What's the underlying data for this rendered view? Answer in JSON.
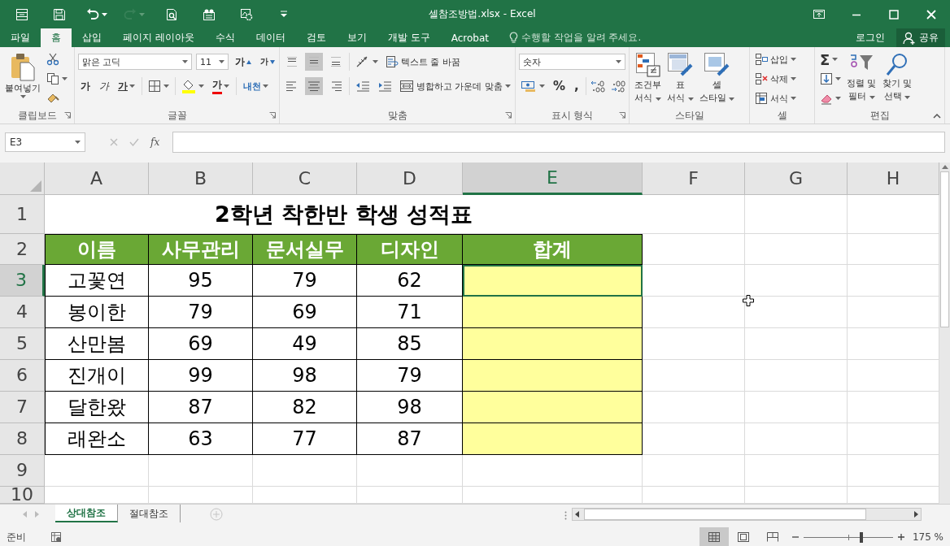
{
  "title_bar": {
    "title": "셀참조방법.xlsx - Excel",
    "quick_access": [
      {
        "kind": "form",
        "disabled": false
      },
      {
        "kind": "save",
        "disabled": false
      },
      {
        "kind": "undo",
        "disabled": false
      },
      {
        "kind": "redo",
        "disabled": true
      },
      {
        "kind": "preview",
        "disabled": false
      },
      {
        "kind": "camera",
        "disabled": false
      },
      {
        "kind": "gear",
        "disabled": false
      },
      {
        "kind": "customize",
        "disabled": false
      }
    ]
  },
  "tabs": [
    {
      "label": "파일",
      "selected": false
    },
    {
      "label": "홈",
      "selected": true
    },
    {
      "label": "삽입",
      "selected": false
    },
    {
      "label": "페이지 레이아웃",
      "selected": false
    },
    {
      "label": "수식",
      "selected": false
    },
    {
      "label": "데이터",
      "selected": false
    },
    {
      "label": "검토",
      "selected": false
    },
    {
      "label": "보기",
      "selected": false
    },
    {
      "label": "개발 도구",
      "selected": false
    },
    {
      "label": "Acrobat",
      "selected": false
    }
  ],
  "tell_me": "수행할 작업을 알려 주세요.",
  "account": {
    "login": "로그인",
    "share": "공유"
  },
  "ribbon": {
    "groups": [
      {
        "kind": "clipboard",
        "label": "클립보드",
        "paste": "붙여넣기"
      },
      {
        "kind": "font",
        "label": "글꼴",
        "font_name": "맑은 고딕",
        "font_size": "11",
        "grow": "가",
        "shrink": "가",
        "bold": "가",
        "italic": "가",
        "underline": "가",
        "font_color": "가",
        "phonetic": "내천"
      },
      {
        "kind": "alignment",
        "label": "맞춤",
        "wrap": "텍스트 줄 바꿈",
        "merge": "병합하고 가운데 맞춤",
        "vertical_align": [
          {
            "selected": false
          },
          {
            "selected": true
          },
          {
            "selected": false
          }
        ],
        "horizontal_align": [
          {
            "selected": false
          },
          {
            "selected": true
          },
          {
            "selected": false
          }
        ]
      },
      {
        "kind": "number",
        "label": "표시 형식",
        "format": "숫자",
        "percent": "%",
        "comma": ","
      },
      {
        "kind": "styles",
        "label": "스타일",
        "buttons": [
          [
            "조건부",
            "서식"
          ],
          [
            "표",
            "서식"
          ],
          [
            "셀",
            "스타일"
          ]
        ]
      },
      {
        "kind": "cells",
        "label": "셀",
        "buttons": [
          "삽입",
          "삭제",
          "서식"
        ]
      },
      {
        "kind": "editing",
        "label": "편집",
        "sum": "Σ",
        "buttons": [
          [
            "정렬 및",
            "필터"
          ],
          [
            "찾기 및",
            "선택"
          ]
        ]
      }
    ]
  },
  "formula_bar": {
    "name_box": "E3",
    "fx": "fx"
  },
  "sheet": {
    "columns": [
      {
        "label": "A",
        "selected": false
      },
      {
        "label": "B",
        "selected": false
      },
      {
        "label": "C",
        "selected": false
      },
      {
        "label": "D",
        "selected": false
      },
      {
        "label": "E",
        "selected": true
      },
      {
        "label": "F",
        "selected": false
      },
      {
        "label": "G",
        "selected": false
      },
      {
        "label": "H",
        "selected": false
      }
    ],
    "rows": [
      {
        "label": "1",
        "selected": false,
        "kind": "title",
        "text": "2학년 착한반 학생 성적표"
      },
      {
        "label": "2",
        "selected": false,
        "kind": "header",
        "cells": [
          "이름",
          "사무관리",
          "문서실무",
          "디자인",
          "합계"
        ]
      },
      {
        "label": "3",
        "selected": true,
        "kind": "data",
        "cells": [
          "고꽃연",
          "95",
          "79",
          "62"
        ]
      },
      {
        "label": "4",
        "selected": false,
        "kind": "data",
        "cells": [
          "봉이한",
          "79",
          "69",
          "71"
        ]
      },
      {
        "label": "5",
        "selected": false,
        "kind": "data",
        "cells": [
          "산만봄",
          "69",
          "49",
          "85"
        ]
      },
      {
        "label": "6",
        "selected": false,
        "kind": "data",
        "cells": [
          "진개이",
          "99",
          "98",
          "79"
        ]
      },
      {
        "label": "7",
        "selected": false,
        "kind": "data",
        "cells": [
          "달한왔",
          "87",
          "82",
          "98"
        ]
      },
      {
        "label": "8",
        "selected": false,
        "kind": "data",
        "cells": [
          "래완소",
          "63",
          "77",
          "87"
        ]
      },
      {
        "label": "9",
        "selected": false,
        "kind": "empty"
      },
      {
        "label": "10",
        "selected": false,
        "kind": "empty"
      }
    ]
  },
  "sheet_tabs": [
    {
      "label": "상대참조",
      "selected": true
    },
    {
      "label": "절대참조",
      "selected": false
    }
  ],
  "status_bar": {
    "status": "준비",
    "views": [
      {
        "kind": "normal",
        "selected": true
      },
      {
        "kind": "page_layout",
        "selected": false
      },
      {
        "kind": "page_break",
        "selected": false
      }
    ],
    "zoom": {
      "level": 0.65,
      "reading": "175 %"
    }
  }
}
